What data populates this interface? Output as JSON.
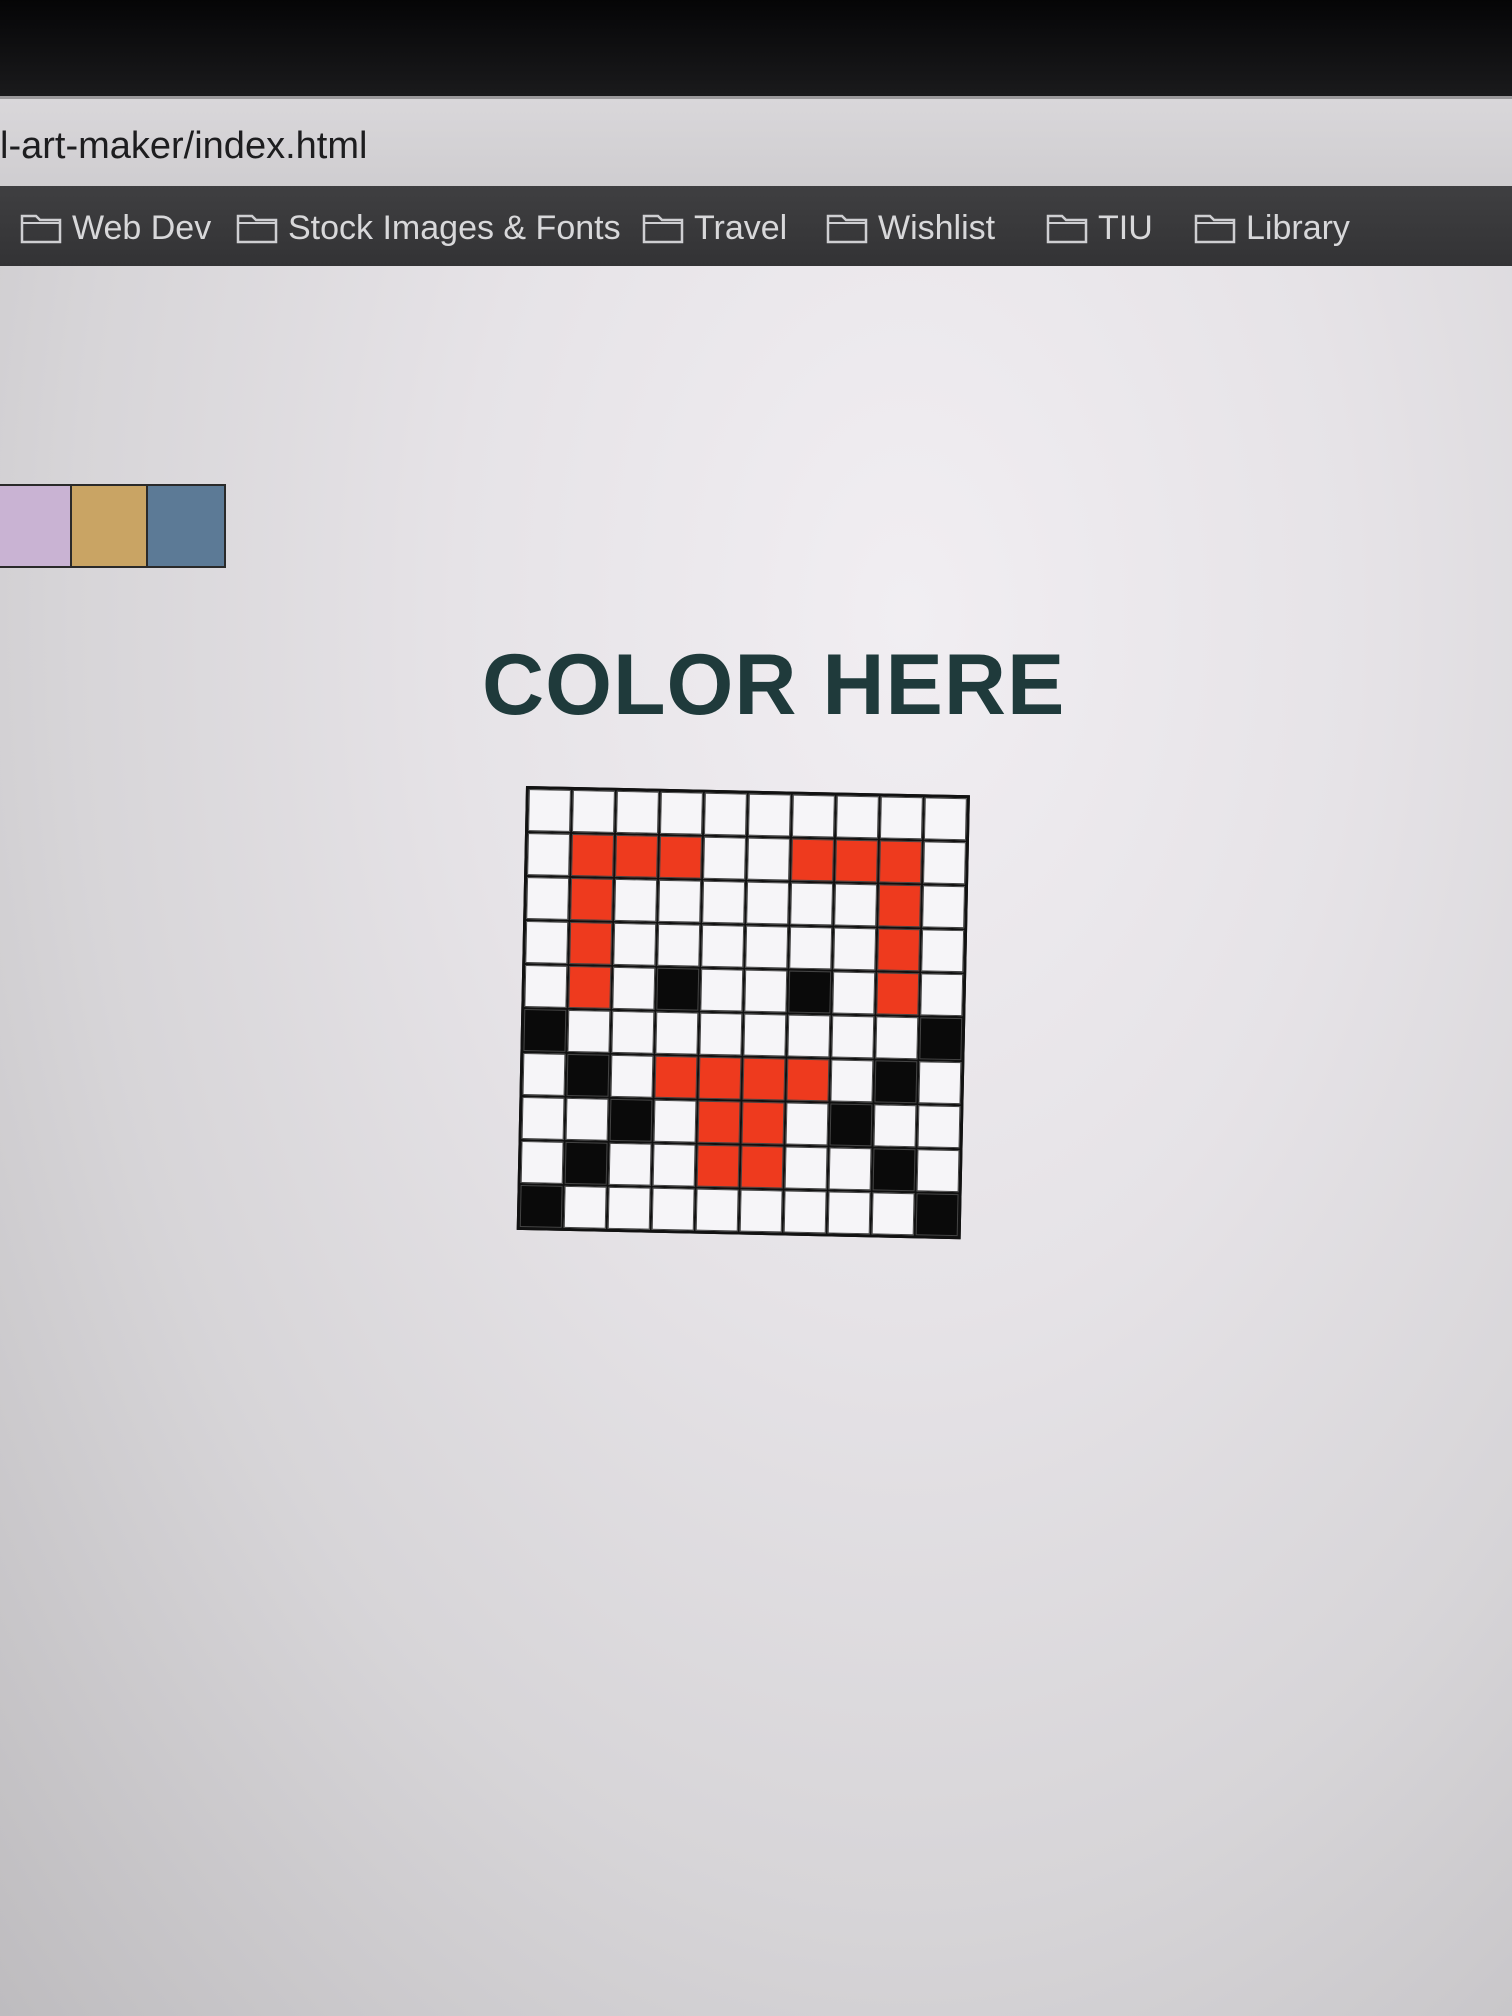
{
  "browser": {
    "url": "l-art-maker/index.html",
    "bookmarks": [
      {
        "label": "Web Dev"
      },
      {
        "label": "Stock Images & Fonts"
      },
      {
        "label": "Travel"
      },
      {
        "label": "Wishlist"
      },
      {
        "label": "TIU"
      },
      {
        "label": "Library"
      }
    ],
    "folder_icon": "folder-icon"
  },
  "palette": {
    "colors": [
      "#c9b3d3",
      "#c9a464",
      "#5c7a96"
    ]
  },
  "canvas": {
    "title": "COLOR HERE",
    "rows": 10,
    "cols": 10,
    "color_key": {
      "W": "#f6f5f8",
      "R": "#ee3a1e",
      "K": "#0a0a0a"
    },
    "cells": [
      "WWWWWWWWWW",
      "WRRRWWRRRW",
      "WRWWWWWWRW",
      "WRWWWWWWRW",
      "WRWKWWKWRW",
      "KWWWWWWWWK",
      "WKWRRRRWKW",
      "WWKWRRWKWW",
      "WKWWRRWWKW",
      "KWWWWWWWWK"
    ]
  }
}
